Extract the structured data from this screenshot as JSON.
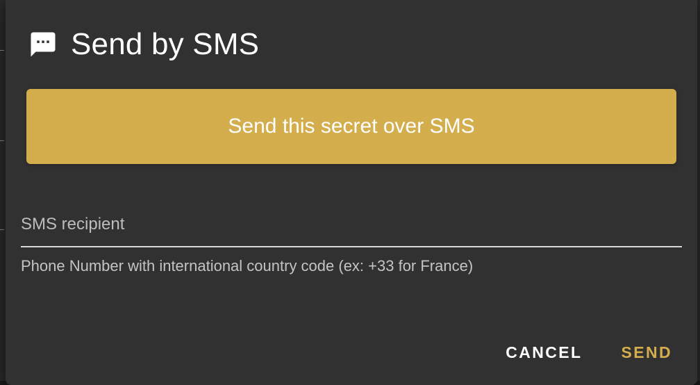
{
  "dialog": {
    "title": "Send by SMS",
    "icon": "sms-message-icon",
    "primary_action_label": "Send this secret over SMS",
    "recipient_field": {
      "placeholder": "SMS recipient",
      "value": "",
      "helper_text": "Phone Number with international country code (ex: +33 for France)"
    },
    "cancel_label": "CANCEL",
    "send_label": "SEND"
  },
  "colors": {
    "accent": "#d4ad4d",
    "dialog_background": "#323132",
    "text_primary": "#ffffff",
    "text_secondary": "#c4c4c4"
  }
}
